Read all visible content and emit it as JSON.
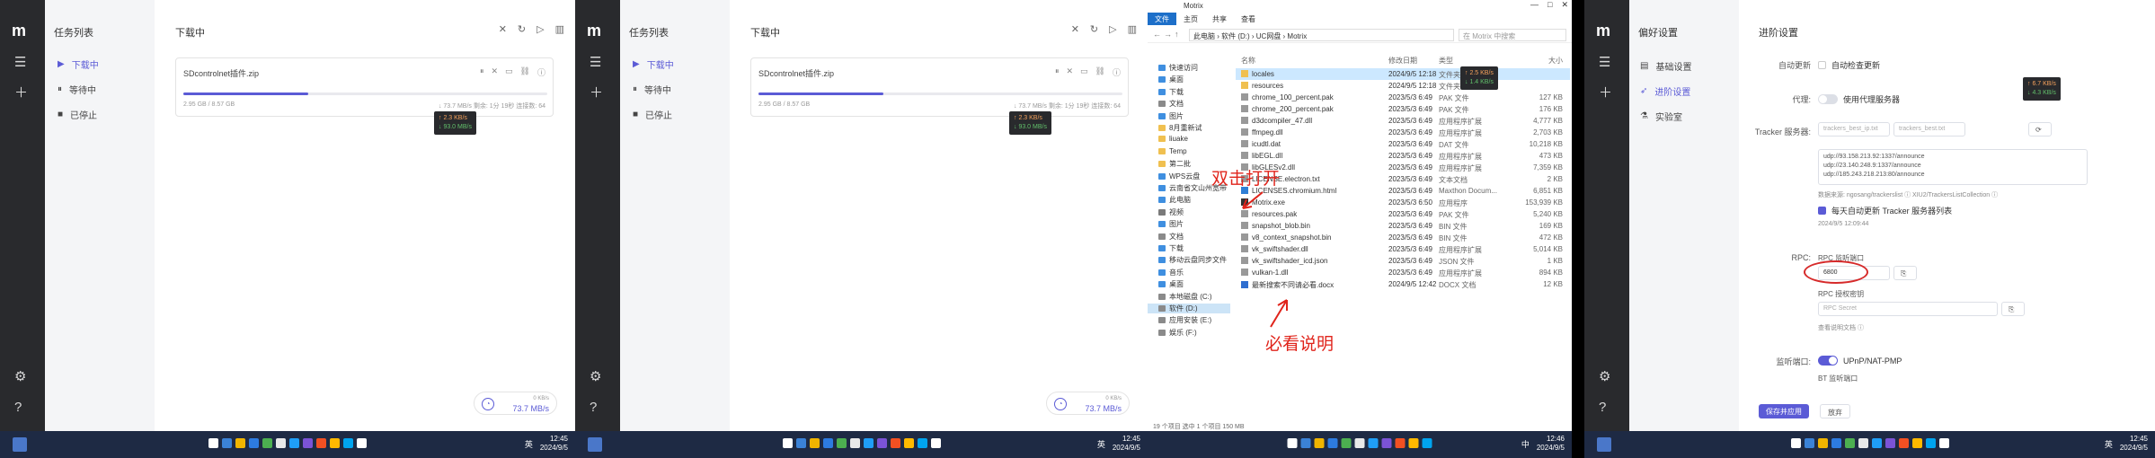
{
  "motrix": {
    "rail": {
      "logo": "m"
    },
    "sidebar": {
      "title": "任务列表",
      "items": [
        {
          "label": "下载中",
          "icon": "play-icon"
        },
        {
          "label": "等待中",
          "icon": "pause-icon"
        },
        {
          "label": "已停止",
          "icon": "stop-icon"
        }
      ]
    },
    "main": {
      "title": "下载中"
    },
    "task": {
      "name": "SDcontrolnet插件.zip",
      "size": "2.95 GB / 8.57 GB",
      "speed": "↓ 73.7 MB/s  剩余: 1分 19秒  连接数: 64",
      "progress": 0.344
    },
    "tooltip": {
      "up": "↑ 2.3 KB/s",
      "down": "↓ 93.0 MB/s"
    },
    "speedometer": {
      "label": "0 KB/s",
      "value": "73.7 MB/s"
    }
  },
  "explorer": {
    "title": "Motrix",
    "ribbon": [
      "文件",
      "主页",
      "共享",
      "查看"
    ],
    "path": "此电脑  ›  软件 (D:)  ›  UC网盘  ›  Motrix",
    "search_placeholder": "在 Motrix 中搜索",
    "headers": [
      "名称",
      "修改日期",
      "类型",
      "大小"
    ],
    "nav": [
      {
        "label": "快速访问",
        "color": "#3f8fe0"
      },
      {
        "label": "桌面",
        "color": "#3f8fe0"
      },
      {
        "label": "下载",
        "color": "#3f8fe0"
      },
      {
        "label": "文档",
        "color": "#8a8a8a"
      },
      {
        "label": "图片",
        "color": "#3f8fe0"
      },
      {
        "label": "8月重新试",
        "color": "#f0c050"
      },
      {
        "label": "liuake",
        "color": "#f0c050"
      },
      {
        "label": "Temp",
        "color": "#f0c050"
      },
      {
        "label": "第二批",
        "color": "#f0c050"
      },
      {
        "label": "WPS云盘",
        "color": "#3f8fe0"
      },
      {
        "label": "云南省文山州宽带",
        "color": "#3f8fe0"
      },
      {
        "label": "此电脑",
        "color": "#3f8fe0"
      },
      {
        "label": "视频",
        "color": "#7a7a7a"
      },
      {
        "label": "图片",
        "color": "#3f8fe0"
      },
      {
        "label": "文档",
        "color": "#8a8a8a"
      },
      {
        "label": "下载",
        "color": "#3f8fe0"
      },
      {
        "label": "移动云盘同步文件",
        "color": "#3f8fe0"
      },
      {
        "label": "音乐",
        "color": "#3f8fe0"
      },
      {
        "label": "桌面",
        "color": "#3f8fe0"
      },
      {
        "label": "本地磁盘 (C:)",
        "color": "#8a8a8a"
      },
      {
        "label": "软件 (D:)",
        "color": "#8a8a8a"
      },
      {
        "label": "应用安装 (E:)",
        "color": "#8a8a8a"
      },
      {
        "label": "娱乐 (F:)",
        "color": "#8a8a8a"
      }
    ],
    "files": [
      {
        "name": "locales",
        "date": "2024/9/5 12:18",
        "type": "文件夹",
        "size": "",
        "color": "#f0c050"
      },
      {
        "name": "resources",
        "date": "2024/9/5 12:18",
        "type": "文件夹",
        "size": "",
        "color": "#f0c050"
      },
      {
        "name": "chrome_100_percent.pak",
        "date": "2023/5/3 6:49",
        "type": "PAK 文件",
        "size": "127 KB",
        "color": "#999"
      },
      {
        "name": "chrome_200_percent.pak",
        "date": "2023/5/3 6:49",
        "type": "PAK 文件",
        "size": "176 KB",
        "color": "#999"
      },
      {
        "name": "d3dcompiler_47.dll",
        "date": "2023/5/3 6:49",
        "type": "应用程序扩展",
        "size": "4,777 KB",
        "color": "#999"
      },
      {
        "name": "ffmpeg.dll",
        "date": "2023/5/3 6:49",
        "type": "应用程序扩展",
        "size": "2,703 KB",
        "color": "#999"
      },
      {
        "name": "icudtl.dat",
        "date": "2023/5/3 6:49",
        "type": "DAT 文件",
        "size": "10,218 KB",
        "color": "#999"
      },
      {
        "name": "libEGL.dll",
        "date": "2023/5/3 6:49",
        "type": "应用程序扩展",
        "size": "473 KB",
        "color": "#999"
      },
      {
        "name": "libGLESv2.dll",
        "date": "2023/5/3 6:49",
        "type": "应用程序扩展",
        "size": "7,359 KB",
        "color": "#999"
      },
      {
        "name": "LICENSE.electron.txt",
        "date": "2023/5/3 6:49",
        "type": "文本文档",
        "size": "2 KB",
        "color": "#999"
      },
      {
        "name": "LICENSES.chromium.html",
        "date": "2023/5/3 6:49",
        "type": "Maxthon Docum...",
        "size": "6,851 KB",
        "color": "#2f7fd6"
      },
      {
        "name": "Motrix.exe",
        "date": "2023/5/3 6:50",
        "type": "应用程序",
        "size": "153,939 KB",
        "color": "#333"
      },
      {
        "name": "resources.pak",
        "date": "2023/5/3 6:49",
        "type": "PAK 文件",
        "size": "5,240 KB",
        "color": "#999"
      },
      {
        "name": "snapshot_blob.bin",
        "date": "2023/5/3 6:49",
        "type": "BIN 文件",
        "size": "169 KB",
        "color": "#999"
      },
      {
        "name": "v8_context_snapshot.bin",
        "date": "2023/5/3 6:49",
        "type": "BIN 文件",
        "size": "472 KB",
        "color": "#999"
      },
      {
        "name": "vk_swiftshader.dll",
        "date": "2023/5/3 6:49",
        "type": "应用程序扩展",
        "size": "5,014 KB",
        "color": "#999"
      },
      {
        "name": "vk_swiftshader_icd.json",
        "date": "2023/5/3 6:49",
        "type": "JSON 文件",
        "size": "1 KB",
        "color": "#999"
      },
      {
        "name": "vulkan-1.dll",
        "date": "2023/5/3 6:49",
        "type": "应用程序扩展",
        "size": "894 KB",
        "color": "#999"
      },
      {
        "name": "最新搜索不同请必看.docx",
        "date": "2024/9/5 12:42",
        "type": "DOCX 文档",
        "size": "12 KB",
        "color": "#2f6fd0"
      }
    ],
    "tooltip": {
      "up": "↑ 2.5 KB/s",
      "down": "↓ 1.4 KB/s"
    },
    "annotation_open": "双击打开",
    "annotation_readme": "必看说明",
    "status": "19 个项目   选中 1 个项目 150 MB"
  },
  "prefs": {
    "sidebar": {
      "title": "偏好设置",
      "items": [
        {
          "label": "基础设置",
          "icon": "sliders-icon"
        },
        {
          "label": "进阶设置",
          "icon": "rocket-icon"
        },
        {
          "label": "实验室",
          "icon": "flask-icon"
        }
      ]
    },
    "title": "进阶设置",
    "auto_update_label": "自动更新",
    "auto_update_text": "自动检查更新",
    "proxy_label": "代理:",
    "proxy_text": "使用代理服务器",
    "tracker_label": "Tracker 服务器:",
    "tracker_sources": [
      "trackers_best_ip.txt",
      "trackers_best.txt"
    ],
    "tracker_list": [
      "udp://93.158.213.92:1337/announce",
      "udp://23.140.248.9:1337/announce",
      "udp://185.243.218.213:80/announce"
    ],
    "tracker_source_note": "数据来源:  ngosang/trackerslist ⓘ    XIU2/TrackersListCollection ⓘ",
    "tracker_auto_text": "每天自动更新 Tracker 服务器列表",
    "tracker_updated": "2024/9/5 12:09:44",
    "rpc_label": "RPC:",
    "rpc_port_label": "RPC 监听端口",
    "rpc_port_value": "6800",
    "rpc_secret_label": "RPC 授权密钥",
    "rpc_secret_placeholder": "RPC Secret",
    "rpc_doc_link": "查看说明文档 ⓘ",
    "port_label": "监听端口:",
    "upnp_text": "UPnP/NAT-PMP",
    "bt_port_label": "BT 监听端口",
    "save_button": "保存并应用",
    "discard_button": "放弃",
    "tooltip": {
      "up": "↑ 6.7 KB/s",
      "down": "↓ 4.3 KB/s"
    }
  },
  "taskbar": [
    {
      "lang": "英",
      "time": "12:45",
      "date": "2024/9/5"
    },
    {
      "lang": "英",
      "time": "12:45",
      "date": "2024/9/5"
    },
    {
      "lang": "中",
      "time": "12:46",
      "date": "2024/9/5"
    },
    {
      "lang": "英",
      "time": "12:45",
      "date": "2024/9/5"
    }
  ],
  "colors": {
    "accent": "#5b5bd6",
    "rail": "#292a2d",
    "taskbar": "#1e2a44",
    "annotation": "#e0241b"
  }
}
